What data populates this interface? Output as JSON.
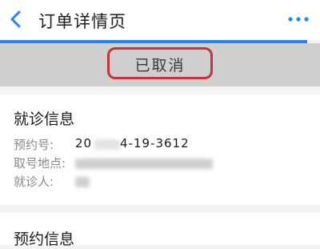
{
  "header": {
    "title": "订单详情页",
    "back_icon": "chevron-left-icon",
    "more_icon": "more-dots-icon"
  },
  "status": {
    "text": "已取消"
  },
  "visit_info": {
    "title": "就诊信息",
    "rows": [
      {
        "label": "预约号:",
        "value_start": "20",
        "value_end": "4-19-3612"
      },
      {
        "label": "取号地点:"
      },
      {
        "label": "就诊人:"
      }
    ]
  },
  "booking_info": {
    "title": "预约信息"
  },
  "colors": {
    "accent": "#2b86e8",
    "highlight": "#c8323e"
  }
}
